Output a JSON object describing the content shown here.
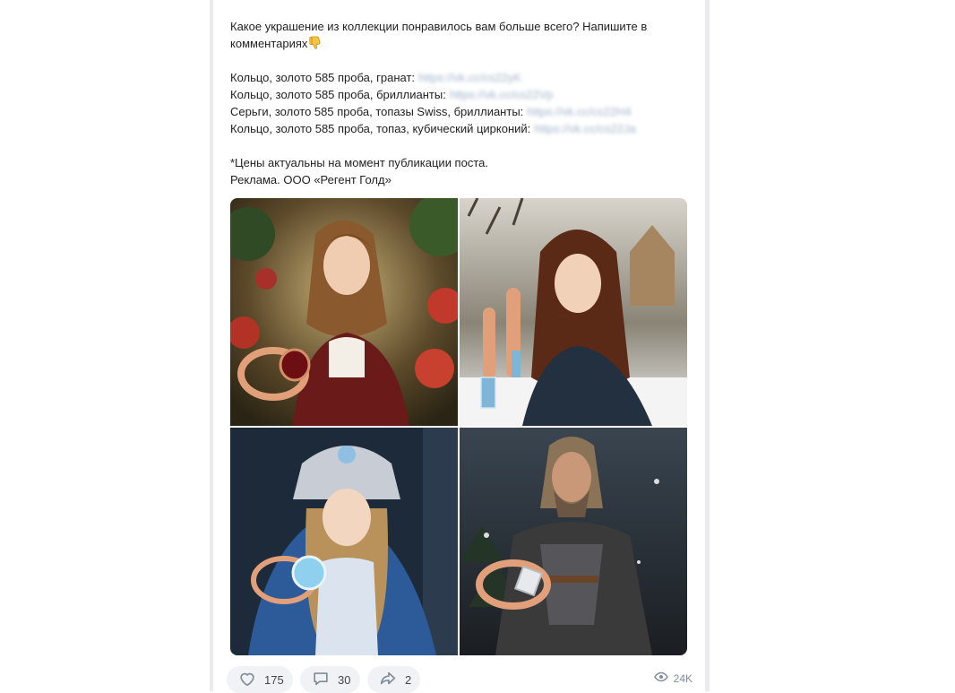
{
  "post": {
    "intro_line1": "Какое украшение из коллекции понравилось вам больше всего? Напишите в",
    "intro_line2": "комментариях",
    "items": [
      {
        "label": "Кольцо, золото 585 проба, гранат:",
        "link": "https://vk.cc/cs22yK"
      },
      {
        "label": "Кольцо, золото 585 проба, бриллианты:",
        "link": "https://vk.cc/cs22Vp"
      },
      {
        "label": "Серьги, золото 585 проба, топазы Swiss, бриллианты:",
        "link": "https://vk.cc/cs22H4"
      },
      {
        "label": "Кольцо, золото 585 проба, топаз, кубический цирконий:",
        "link": "https://vk.cc/cs22Ja"
      }
    ],
    "note": "*Цены актуальны на момент публикации поста.",
    "ad": "Реклама. ООО «Регент Голд»"
  },
  "gallery": [
    {
      "icon": "photo-girl-garnet-ring"
    },
    {
      "icon": "photo-girl-topaz-earrings"
    },
    {
      "icon": "photo-snow-maiden-topaz-ring"
    },
    {
      "icon": "photo-warrior-diamond-ring"
    }
  ],
  "actions": {
    "likes": "175",
    "comments": "30",
    "shares": "2",
    "views": "24K"
  },
  "colors": {
    "pill_bg": "#f0f2f5",
    "icon_gray": "#818c99",
    "link_blur": "#9fb2c9",
    "gold": "#e2a07a"
  }
}
